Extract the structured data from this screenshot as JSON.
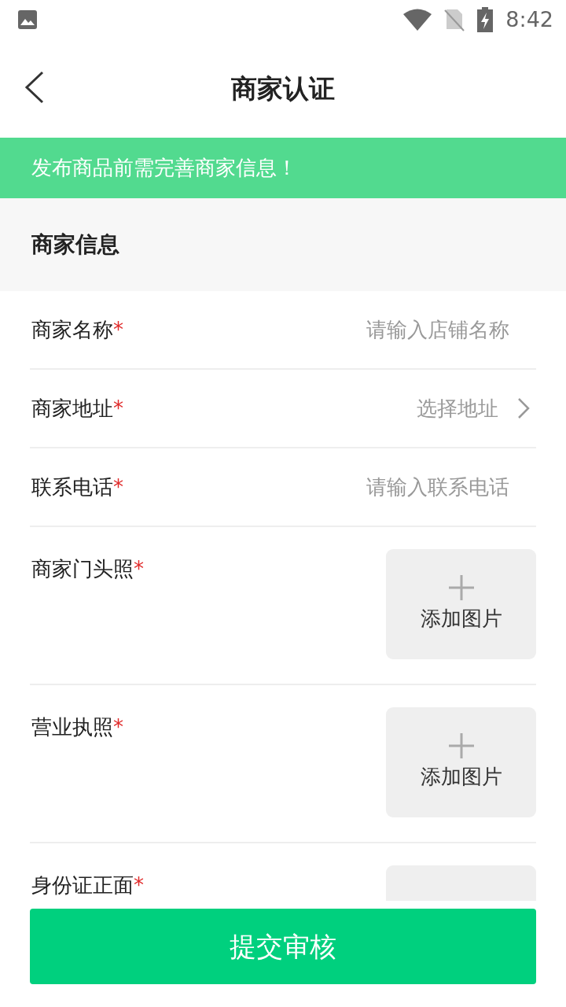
{
  "status_bar": {
    "time": "8:42"
  },
  "header": {
    "title": "商家认证"
  },
  "notice": "发布商品前需完善商家信息！",
  "section": {
    "title": "商家信息"
  },
  "fields": [
    {
      "kind": "text",
      "label": "商家名称",
      "required_mark": "*",
      "placeholder": "请输入店铺名称"
    },
    {
      "kind": "select",
      "label": "商家地址",
      "required_mark": "*",
      "placeholder": "选择地址"
    },
    {
      "kind": "text",
      "label": "联系电话",
      "required_mark": "*",
      "placeholder": "请输入联系电话"
    },
    {
      "kind": "image",
      "label": "商家门头照",
      "required_mark": "*",
      "button": "添加图片"
    },
    {
      "kind": "image",
      "label": "营业执照",
      "required_mark": "*",
      "button": "添加图片"
    },
    {
      "kind": "image",
      "label": "身份证正面",
      "required_mark": "*"
    }
  ],
  "submit": "提交审核"
}
